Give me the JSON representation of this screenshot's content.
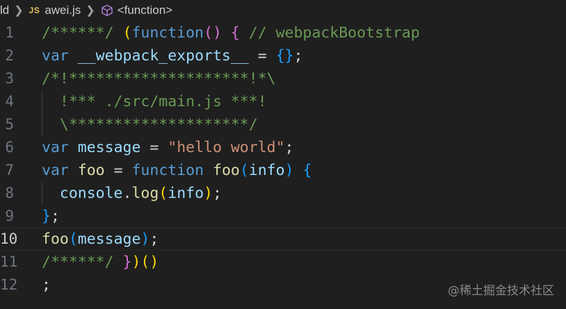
{
  "breadcrumb": {
    "folder": "ld",
    "file_badge": "JS",
    "file": "awei.js",
    "symbol": "<function>"
  },
  "editor": {
    "current_line": 10,
    "lines": [
      {
        "n": "1",
        "tokens": [
          {
            "t": "/******/ ",
            "c": "comment"
          },
          {
            "t": "(",
            "c": "br1"
          },
          {
            "t": "function",
            "c": "kw"
          },
          {
            "t": "()",
            "c": "br2"
          },
          {
            "t": " ",
            "c": "op"
          },
          {
            "t": "{",
            "c": "br2"
          },
          {
            "t": " // webpackBootstrap",
            "c": "comment"
          }
        ]
      },
      {
        "n": "2",
        "tokens": [
          {
            "t": "var",
            "c": "kw"
          },
          {
            "t": " ",
            "c": "op"
          },
          {
            "t": "__webpack_exports__",
            "c": "var"
          },
          {
            "t": " = ",
            "c": "op"
          },
          {
            "t": "{}",
            "c": "br3"
          },
          {
            "t": ";",
            "c": "op"
          }
        ]
      },
      {
        "n": "3",
        "tokens": [
          {
            "t": "/*!********************!*\\",
            "c": "comment"
          }
        ]
      },
      {
        "n": "4",
        "guide": true,
        "tokens": [
          {
            "t": "  !*** ./src/main.js ***!",
            "c": "comment"
          }
        ]
      },
      {
        "n": "5",
        "guide": true,
        "tokens": [
          {
            "t": "  \\********************/",
            "c": "comment"
          }
        ]
      },
      {
        "n": "6",
        "tokens": [
          {
            "t": "var",
            "c": "kw"
          },
          {
            "t": " ",
            "c": "op"
          },
          {
            "t": "message",
            "c": "var"
          },
          {
            "t": " = ",
            "c": "op"
          },
          {
            "t": "\"hello world\"",
            "c": "str"
          },
          {
            "t": ";",
            "c": "op"
          }
        ]
      },
      {
        "n": "7",
        "tokens": [
          {
            "t": "var",
            "c": "kw"
          },
          {
            "t": " ",
            "c": "op"
          },
          {
            "t": "foo",
            "c": "fn"
          },
          {
            "t": " = ",
            "c": "op"
          },
          {
            "t": "function",
            "c": "kw"
          },
          {
            "t": " ",
            "c": "op"
          },
          {
            "t": "foo",
            "c": "fn"
          },
          {
            "t": "(",
            "c": "br3"
          },
          {
            "t": "info",
            "c": "var"
          },
          {
            "t": ")",
            "c": "br3"
          },
          {
            "t": " ",
            "c": "op"
          },
          {
            "t": "{",
            "c": "br3"
          }
        ]
      },
      {
        "n": "8",
        "guide": true,
        "tokens": [
          {
            "t": "  ",
            "c": "op"
          },
          {
            "t": "console",
            "c": "var"
          },
          {
            "t": ".",
            "c": "op"
          },
          {
            "t": "log",
            "c": "fn"
          },
          {
            "t": "(",
            "c": "br1"
          },
          {
            "t": "info",
            "c": "var"
          },
          {
            "t": ")",
            "c": "br1"
          },
          {
            "t": ";",
            "c": "op"
          }
        ]
      },
      {
        "n": "9",
        "tokens": [
          {
            "t": "}",
            "c": "br3"
          },
          {
            "t": ";",
            "c": "op"
          }
        ]
      },
      {
        "n": "10",
        "tokens": [
          {
            "t": "foo",
            "c": "fn"
          },
          {
            "t": "(",
            "c": "br3"
          },
          {
            "t": "message",
            "c": "var"
          },
          {
            "t": ")",
            "c": "br3"
          },
          {
            "t": ";",
            "c": "op"
          }
        ]
      },
      {
        "n": "11",
        "tokens": [
          {
            "t": "/******/ ",
            "c": "comment"
          },
          {
            "t": "}",
            "c": "br2"
          },
          {
            "t": ")",
            "c": "br1"
          },
          {
            "t": "()",
            "c": "br1"
          }
        ]
      },
      {
        "n": "12",
        "tokens": [
          {
            "t": ";",
            "c": "op"
          }
        ]
      }
    ]
  },
  "watermark": "@稀土掘金技术社区",
  "colors": {
    "background": "#1f1f1f",
    "comment": "#6a9955",
    "keyword": "#569cd6",
    "variable": "#9cdcfe",
    "function": "#dcdcaa",
    "string": "#ce9178",
    "bracket_gold": "#ffd700",
    "bracket_orchid": "#da70d6",
    "bracket_blue": "#179fff"
  }
}
